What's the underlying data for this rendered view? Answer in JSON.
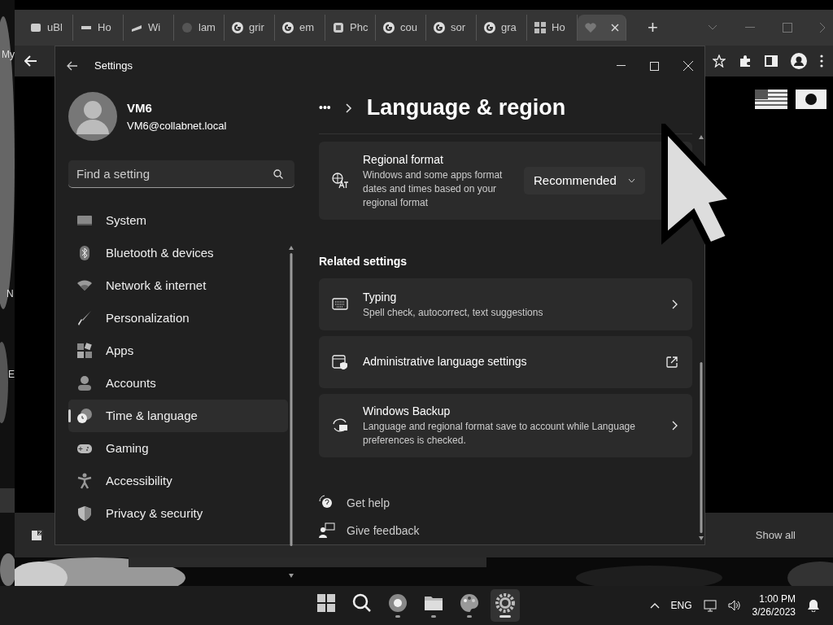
{
  "desktop": {
    "icon_labels": [
      "My",
      "N",
      "E"
    ]
  },
  "browser": {
    "tabs": [
      {
        "label": "uBl",
        "selected": false
      },
      {
        "label": "Ho",
        "selected": false
      },
      {
        "label": "Wi",
        "selected": false
      },
      {
        "label": "lam",
        "selected": false
      },
      {
        "label": "grir",
        "selected": false
      },
      {
        "label": "em",
        "selected": false
      },
      {
        "label": "Phc",
        "selected": false
      },
      {
        "label": "cou",
        "selected": false
      },
      {
        "label": "sor",
        "selected": false
      },
      {
        "label": "gra",
        "selected": false
      },
      {
        "label": "Ho",
        "selected": false
      },
      {
        "selected": true
      }
    ],
    "new_tab": "+",
    "download_bar": {
      "button": "Show all"
    }
  },
  "settings": {
    "title": "Settings",
    "user": {
      "name": "VM6",
      "email": "VM6@collabnet.local"
    },
    "search": {
      "placeholder": "Find a setting"
    },
    "nav": [
      {
        "label": "System",
        "selected": false
      },
      {
        "label": "Bluetooth & devices",
        "selected": false
      },
      {
        "label": "Network & internet",
        "selected": false
      },
      {
        "label": "Personalization",
        "selected": false
      },
      {
        "label": "Apps",
        "selected": false
      },
      {
        "label": "Accounts",
        "selected": false
      },
      {
        "label": "Time & language",
        "selected": true
      },
      {
        "label": "Gaming",
        "selected": false
      },
      {
        "label": "Accessibility",
        "selected": false
      },
      {
        "label": "Privacy & security",
        "selected": false
      }
    ],
    "breadcrumb": {
      "ellipsis": "•••",
      "title": "Language & region"
    },
    "regional_format": {
      "title": "Regional format",
      "description": "Windows and some apps format dates and times based on your regional format",
      "value": "Recommended"
    },
    "related_heading": "Related settings",
    "related": [
      {
        "kind": "chevron",
        "title": "Typing",
        "description": "Spell check, autocorrect, text suggestions"
      },
      {
        "kind": "external",
        "title": "Administrative language settings"
      },
      {
        "kind": "chevron",
        "title": "Windows Backup",
        "description": "Language and regional format save to account while Language preferences is checked."
      }
    ],
    "links": [
      "Get help",
      "Give feedback"
    ]
  },
  "taskbar": {
    "apps": [
      {
        "selected": false,
        "running": false
      },
      {
        "selected": false,
        "running": false
      },
      {
        "selected": false,
        "running": true
      },
      {
        "selected": false,
        "running": true
      },
      {
        "selected": false,
        "running": true
      },
      {
        "selected": true,
        "running": true
      }
    ],
    "language": "ENG",
    "time": "1:00 PM",
    "date": "3/26/2023"
  }
}
